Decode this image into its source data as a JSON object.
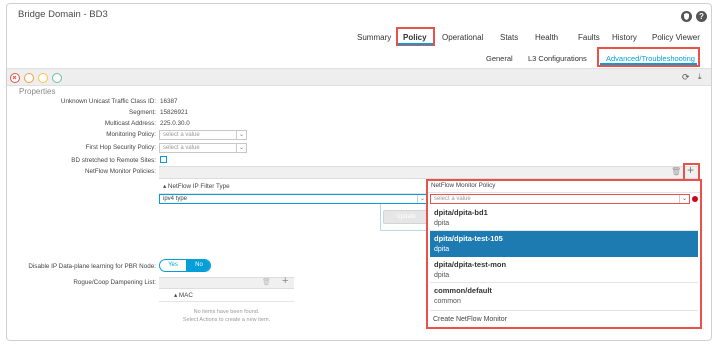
{
  "window": {
    "title": "Bridge Domain - BD3"
  },
  "top_tabs": [
    {
      "label": "Summary"
    },
    {
      "label": "Policy"
    },
    {
      "label": "Operational"
    },
    {
      "label": "Stats"
    },
    {
      "label": "Health"
    },
    {
      "label": "Faults"
    },
    {
      "label": "History"
    },
    {
      "label": "Policy Viewer"
    }
  ],
  "sub_tabs": [
    {
      "label": "General"
    },
    {
      "label": "L3 Configurations"
    },
    {
      "label": "Advanced/Troubleshooting"
    }
  ],
  "section": {
    "title": "Properties"
  },
  "fields": {
    "unknown_unicast": {
      "label": "Unknown Unicast Traffic Class ID:",
      "value": "16387"
    },
    "segment": {
      "label": "Segment:",
      "value": "15826921"
    },
    "multicast": {
      "label": "Multicast Address:",
      "value": "225.0.30.0"
    },
    "monitoring": {
      "label": "Monitoring Policy:",
      "placeholder": "select a value"
    },
    "first_hop": {
      "label": "First Hop Security Policy:",
      "placeholder": "select a value"
    },
    "bd_stretched": {
      "label": "BD stretched to Remote Sites:"
    },
    "netflow": {
      "label": "NetFlow Monitor Policies:"
    },
    "disable_ip": {
      "label": "Disable IP Data-plane learning for PBR Node:",
      "yes": "Yes",
      "no": "No",
      "selected": "No"
    },
    "rogue": {
      "label": "Rogue/Coop Dampening List:"
    }
  },
  "netflow_table": {
    "col_filter": "NetFlow IP Filter Type",
    "col_policy": "NetFlow Monitor Policy",
    "filter_value": "ipv4 type",
    "policy_placeholder": "select a value",
    "update_btn": "Update"
  },
  "dropdown": {
    "items": [
      {
        "name": "dpita/dpita-bd1",
        "tenant": "dpita",
        "selected": false
      },
      {
        "name": "dpita/dpita-test-105",
        "tenant": "dpita",
        "selected": true
      },
      {
        "name": "dpita/dpita-test-mon",
        "tenant": "dpita",
        "selected": false
      },
      {
        "name": "common/default",
        "tenant": "common",
        "selected": false
      }
    ],
    "create_label": "Create NetFlow Monitor"
  },
  "mac_table": {
    "col": "MAC",
    "empty_line1": "No items have been found.",
    "empty_line2": "Select Actions to create a new item."
  },
  "icons": {
    "toolbar": [
      "close-circle-icon",
      "warning-circle-icon",
      "caution-circle-icon",
      "info-circle-icon"
    ],
    "top_right": [
      "shield-icon",
      "help-icon"
    ]
  },
  "colors": {
    "accent": "#049fd9",
    "highlight": "#e8524a",
    "selected_row": "#1e7bb2"
  }
}
